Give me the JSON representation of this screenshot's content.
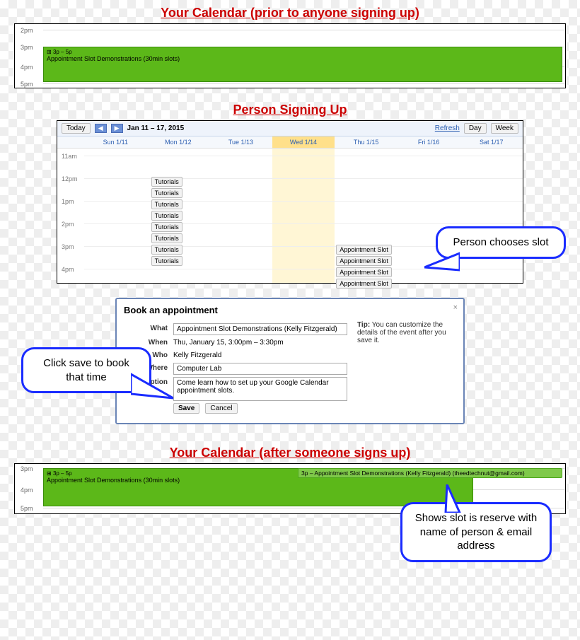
{
  "section1": {
    "caption": "Your Calendar (prior to anyone signing up)",
    "hours": [
      "2pm",
      "3pm",
      "4pm",
      "5pm"
    ],
    "event_time": "3p – 5p",
    "event_title": "Appointment Slot Demonstrations (30min slots)"
  },
  "section2": {
    "caption": "Person Signing Up",
    "today": "Today",
    "range": "Jan 11 – 17, 2015",
    "refresh": "Refresh",
    "view_day": "Day",
    "view_week": "Week",
    "days": [
      "Sun 1/11",
      "Mon 1/12",
      "Tue 1/13",
      "Wed 1/14",
      "Thu 1/15",
      "Fri 1/16",
      "Sat 1/17"
    ],
    "highlight_day_index": 3,
    "hours": [
      "11am",
      "12pm",
      "1pm",
      "2pm",
      "3pm",
      "4pm"
    ],
    "tutorial_label": "Tutorials",
    "appt_label": "Appointment Slot",
    "callout": "Person chooses slot"
  },
  "dialog": {
    "title": "Book an appointment",
    "what_label": "What",
    "what_value": "Appointment Slot Demonstrations (Kelly Fitzgerald)",
    "when_label": "When",
    "when_value": "Thu, January 15, 3:00pm – 3:30pm",
    "who_label": "Who",
    "who_value": "Kelly Fitzgerald",
    "where_label": "Where",
    "where_value": "Computer Lab",
    "desc_label": "Description",
    "desc_value": "Come learn how to set up your Google Calendar appointment slots.",
    "save": "Save",
    "cancel": "Cancel",
    "tip_label": "Tip:",
    "tip_text": " You can customize the details of the event after you save it.",
    "callout": "Click save to book that time"
  },
  "section3": {
    "caption": "Your Calendar (after someone signs up)",
    "hours": [
      "3pm",
      "4pm",
      "5pm"
    ],
    "event_time": "3p – 5p",
    "event_title": "Appointment Slot Demonstrations (30min slots)",
    "booked": "3p – Appointment Slot Demonstrations (Kelly Fitzgerald) (theedtechnut@gmail.com)",
    "callout": "Shows slot is reserve with name of person & email address"
  }
}
